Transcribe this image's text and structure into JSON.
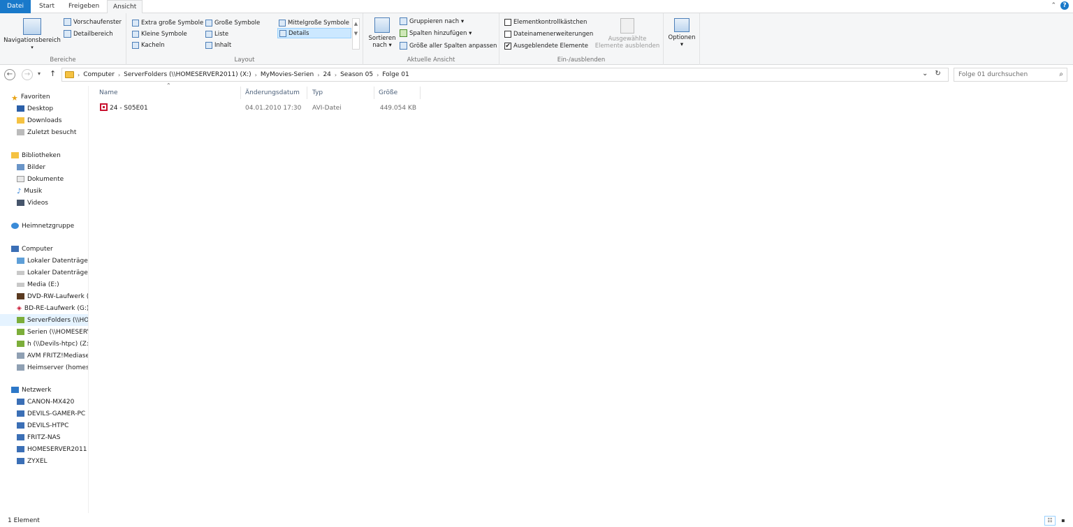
{
  "tabs": {
    "file": "Datei",
    "start": "Start",
    "share": "Freigeben",
    "view": "Ansicht"
  },
  "ribbon": {
    "panes": {
      "label": "Bereiche",
      "navigation_pane": "Navigationsbereich",
      "preview_pane": "Vorschaufenster",
      "details_pane": "Detailbereich"
    },
    "layout": {
      "label": "Layout",
      "extra_large": "Extra große Symbole",
      "large": "Große Symbole",
      "medium": "Mittelgroße Symbole",
      "small": "Kleine Symbole",
      "list": "Liste",
      "details": "Details",
      "tiles": "Kacheln",
      "content": "Inhalt"
    },
    "current_view": {
      "label": "Aktuelle Ansicht",
      "sort_by_1": "Sortieren",
      "sort_by_2": "nach ▾",
      "group_by": "Gruppieren nach ▾",
      "add_columns": "Spalten hinzufügen ▾",
      "size_columns": "Größe aller Spalten anpassen"
    },
    "show_hide": {
      "label": "Ein-/ausblenden",
      "item_checkboxes": "Elementkontrollkästchen",
      "file_extensions": "Dateinamenerweiterungen",
      "hidden_items": "Ausgeblendete Elemente",
      "hidden_items_checked": "✔",
      "hide_selected_1": "Ausgewählte",
      "hide_selected_2": "Elemente ausblenden"
    },
    "options": {
      "label": "Optionen",
      "caret": "▾"
    }
  },
  "address": {
    "crumbs": [
      "Computer",
      "ServerFolders (\\\\HOMESERVER2011) (X:)",
      "MyMovies-Serien",
      "24",
      "Season 05",
      "Folge 01"
    ],
    "search_placeholder": "Folge 01 durchsuchen"
  },
  "nav": {
    "favorites": "Favoriten",
    "desktop": "Desktop",
    "downloads": "Downloads",
    "recent": "Zuletzt besucht",
    "libraries": "Bibliotheken",
    "pictures": "Bilder",
    "documents": "Dokumente",
    "music": "Musik",
    "videos": "Videos",
    "homegroup": "Heimnetzgruppe",
    "computer": "Computer",
    "drive1": "Lokaler Datenträger",
    "drive2": "Lokaler Datenträger",
    "media": "Media (E:)",
    "dvd": "DVD-RW-Laufwerk (",
    "bd": "BD-RE-Laufwerk (G:)",
    "serverfolders": "ServerFolders (\\\\HO",
    "serien": "Serien (\\\\HOMESERV",
    "h": "h (\\\\Devils-htpc) (Z:",
    "avm": "AVM FRITZ!Mediase",
    "heimserver": "Heimserver (homese",
    "network": "Netzwerk",
    "canon": "CANON-MX420",
    "gamer": "DEVILS-GAMER-PC",
    "htpc": "DEVILS-HTPC",
    "fritz": "FRITZ-NAS",
    "homeserver": "HOMESERVER2011",
    "zyxel": "ZYXEL"
  },
  "columns": {
    "name": "Name",
    "date": "Änderungsdatum",
    "type": "Typ",
    "size": "Größe"
  },
  "files": [
    {
      "name": "24 - S05E01",
      "date": "04.01.2010 17:30",
      "type": "AVI-Datei",
      "size": "449.054 KB"
    }
  ],
  "status": {
    "count": "1 Element"
  },
  "colors": {
    "accent": "#1979ca",
    "selection": "#cce8ff",
    "folder": "#f5c242",
    "avi": "#c8102e"
  }
}
